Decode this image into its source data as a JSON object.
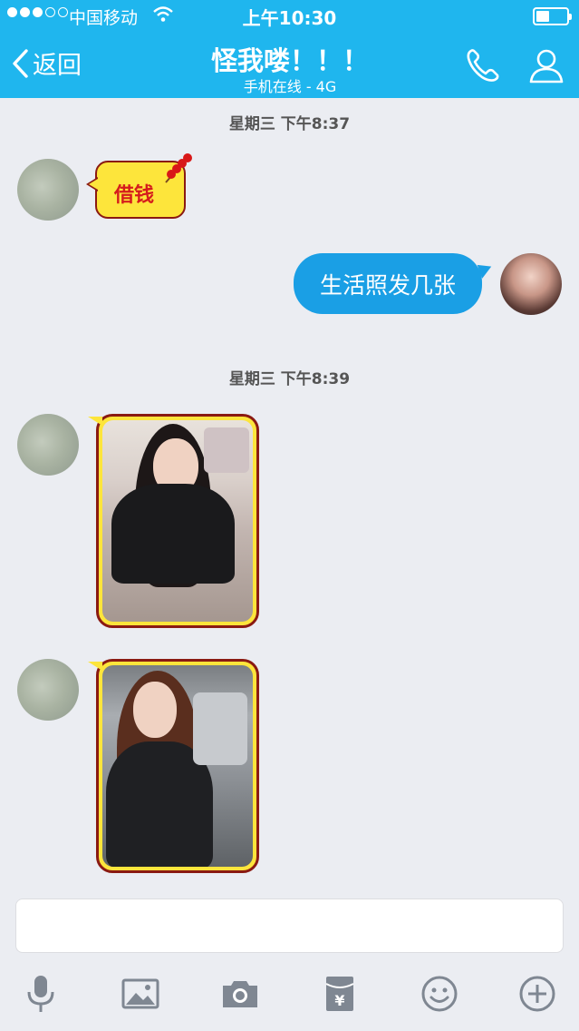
{
  "status_bar": {
    "carrier": "中国移动",
    "time": "上午10:30",
    "signal_filled": 3,
    "signal_total": 5
  },
  "nav": {
    "back_label": "返回",
    "title": "怪我喽！！！",
    "subtitle": "手机在线 - 4G",
    "accent_color": "#1fb6ee"
  },
  "chat": {
    "timestamps": [
      "星期三 下午8:37",
      "星期三 下午8:39"
    ],
    "messages": [
      {
        "from": "friend",
        "type": "sticker",
        "text": "借钱"
      },
      {
        "from": "me",
        "type": "text",
        "text": "生活照发几张"
      },
      {
        "from": "friend",
        "type": "photo"
      },
      {
        "from": "friend",
        "type": "photo"
      }
    ]
  },
  "toolbar": {
    "icons": [
      "microphone-icon",
      "image-icon",
      "camera-icon",
      "red-packet-icon",
      "emoji-icon",
      "plus-icon"
    ]
  }
}
